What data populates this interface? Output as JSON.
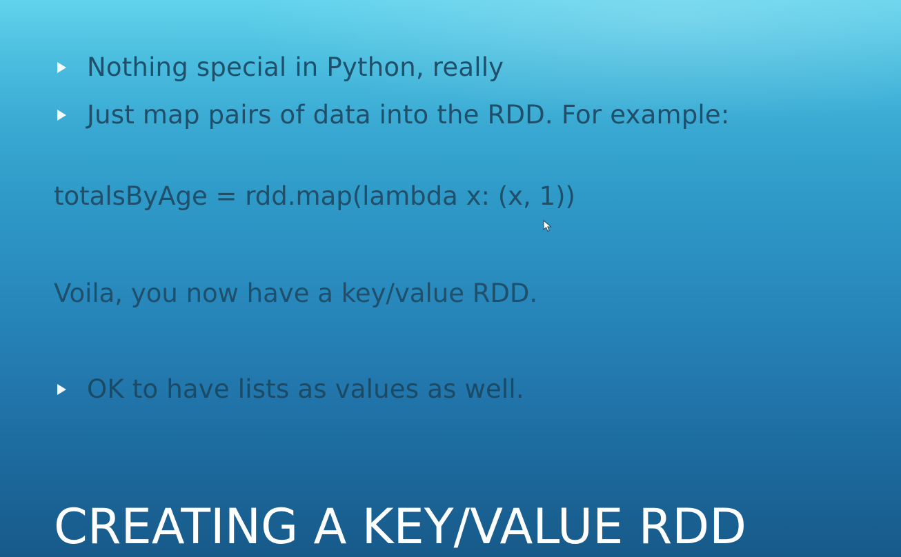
{
  "slide": {
    "title": "CREATING A KEY/VALUE RDD",
    "bullets": [
      {
        "text": "Nothing special in Python, really",
        "icon": "triangle-bullet-icon"
      },
      {
        "text": "Just map pairs of data into the RDD. For example:",
        "icon": "triangle-bullet-icon"
      }
    ],
    "code": "totalsByAge = rdd.map(lambda x: (x, 1))",
    "note": "Voila, you now have a key/value RDD.",
    "final_bullet": {
      "text": "OK to have lists as values as well.",
      "icon": "triangle-bullet-icon"
    }
  },
  "colors": {
    "background_top": "#62d3ec",
    "background_bottom": "#175a8a",
    "body_text": "#1f4f6a",
    "title_text": "#ffffff",
    "bullet_marker": "#ffffff"
  },
  "cursor": {
    "icon": "mouse-pointer-icon"
  }
}
